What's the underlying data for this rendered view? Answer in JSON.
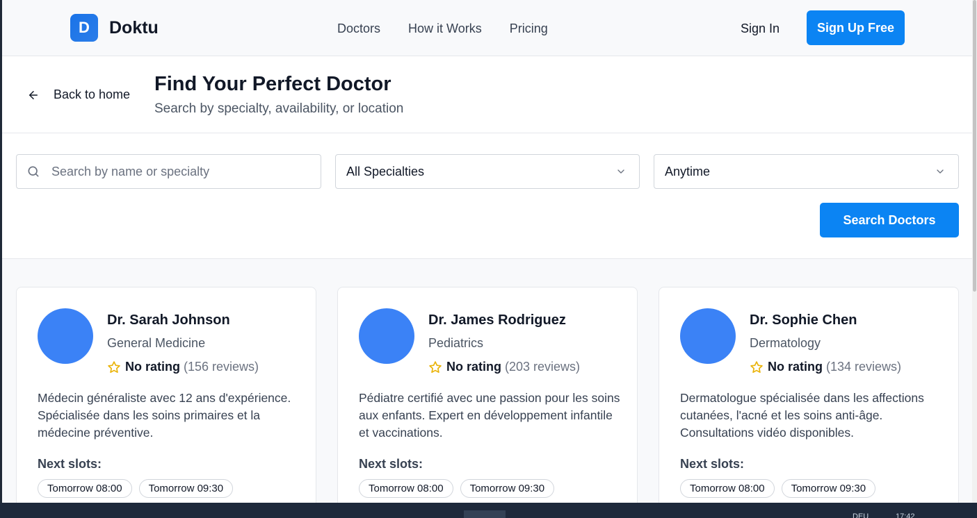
{
  "header": {
    "logo_letter": "D",
    "brand": "Doktu",
    "nav": [
      "Doctors",
      "How it Works",
      "Pricing"
    ],
    "sign_in": "Sign In",
    "sign_up": "Sign Up Free"
  },
  "title_section": {
    "back_label": "Back to home",
    "title": "Find Your Perfect Doctor",
    "subtitle": "Search by specialty, availability, or location"
  },
  "search": {
    "placeholder": "Search by name or specialty",
    "specialty_selected": "All Specialties",
    "time_selected": "Anytime",
    "button": "Search Doctors"
  },
  "doctors": [
    {
      "name": "Dr. Sarah Johnson",
      "specialty": "General Medicine",
      "rating_label": "No rating",
      "reviews": "(156 reviews)",
      "bio": "Médecin généraliste avec 12 ans d'expérience. Spécialisée dans les soins primaires et la médecine préventive.",
      "slots_label": "Next slots:",
      "slots": [
        "Tomorrow 08:00",
        "Tomorrow 09:30"
      ]
    },
    {
      "name": "Dr. James Rodriguez",
      "specialty": "Pediatrics",
      "rating_label": "No rating",
      "reviews": "(203 reviews)",
      "bio": "Pédiatre certifié avec une passion pour les soins aux enfants. Expert en développement infantile et vaccinations.",
      "slots_label": "Next slots:",
      "slots": [
        "Tomorrow 08:00",
        "Tomorrow 09:30"
      ]
    },
    {
      "name": "Dr. Sophie Chen",
      "specialty": "Dermatology",
      "rating_label": "No rating",
      "reviews": "(134 reviews)",
      "bio": "Dermatologue spécialisée dans les affections cutanées, l'acné et les soins anti-âge. Consultations vidéo disponibles.",
      "slots_label": "Next slots:",
      "slots": [
        "Tomorrow 08:00",
        "Tomorrow 09:30"
      ]
    }
  ],
  "taskbar": {
    "lang": "DEU",
    "time": "17:42"
  },
  "colors": {
    "primary": "#0b84f3",
    "avatar": "#3b82f6",
    "star": "#eab308"
  },
  "icons": [
    "arrow-left-icon",
    "search-icon",
    "chevron-down-icon",
    "star-outline-icon"
  ]
}
